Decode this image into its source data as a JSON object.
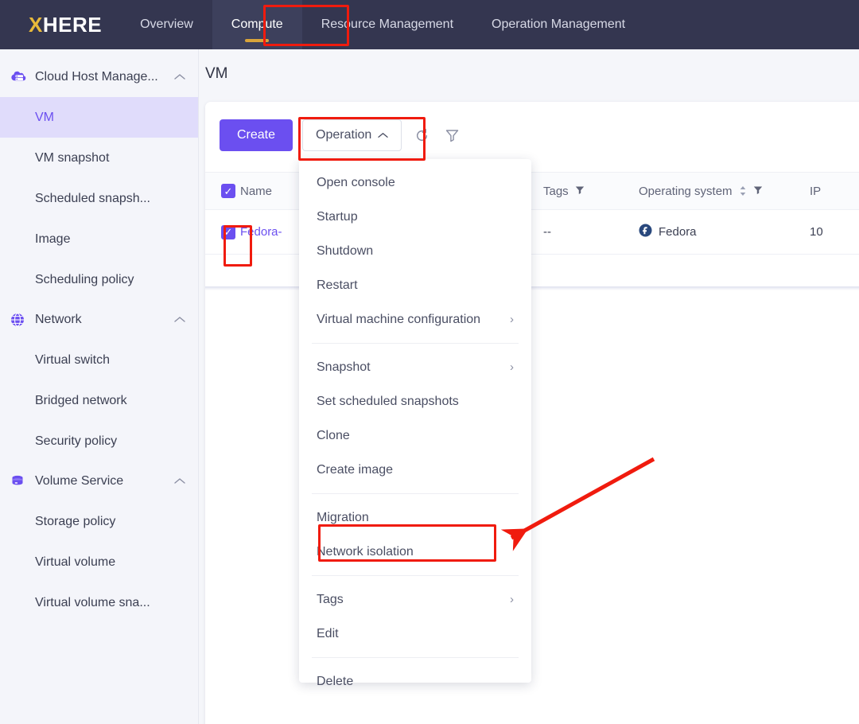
{
  "topnav": {
    "logo_x": "X",
    "logo_rest": "HERE",
    "items": [
      {
        "label": "Overview",
        "active": false
      },
      {
        "label": "Compute",
        "active": true
      },
      {
        "label": "Resource Management",
        "active": false
      },
      {
        "label": "Operation Management",
        "active": false
      }
    ]
  },
  "sidebar": {
    "groups": [
      {
        "label": "Cloud Host Manage...",
        "icon": "cloud-server-icon",
        "chevron": "⌃",
        "items": [
          {
            "label": "VM",
            "active": true
          },
          {
            "label": "VM snapshot",
            "active": false
          },
          {
            "label": "Scheduled snapsh...",
            "active": false
          },
          {
            "label": "Image",
            "active": false
          },
          {
            "label": "Scheduling policy",
            "active": false
          }
        ]
      },
      {
        "label": "Network",
        "icon": "globe-icon",
        "chevron": "⌃",
        "items": [
          {
            "label": "Virtual switch",
            "active": false
          },
          {
            "label": "Bridged network",
            "active": false
          },
          {
            "label": "Security policy",
            "active": false
          }
        ]
      },
      {
        "label": "Volume Service",
        "icon": "database-icon",
        "chevron": "⌃",
        "items": [
          {
            "label": "Storage policy",
            "active": false
          },
          {
            "label": "Virtual volume",
            "active": false
          },
          {
            "label": "Virtual volume sna...",
            "active": false
          }
        ]
      }
    ]
  },
  "page": {
    "title": "VM"
  },
  "toolbar": {
    "create_label": "Create",
    "operation_label": "Operation",
    "operation_chevron": "⌃",
    "refresh_icon": "refresh-icon",
    "filter_icon": "filter-icon"
  },
  "table": {
    "headers": {
      "name": "Name",
      "tags": "Tags",
      "os": "Operating system",
      "ip": "IP"
    },
    "header_checkbox_checked": true,
    "rows": [
      {
        "checked": true,
        "name": "Fedora-",
        "tags": "--",
        "os": "Fedora",
        "os_icon": "fedora-icon",
        "ip": "10"
      }
    ]
  },
  "menu": {
    "items": [
      {
        "label": "Open console",
        "submenu": false,
        "sep_after": false
      },
      {
        "label": "Startup",
        "submenu": false,
        "sep_after": false
      },
      {
        "label": "Shutdown",
        "submenu": false,
        "sep_after": false
      },
      {
        "label": "Restart",
        "submenu": false,
        "sep_after": false
      },
      {
        "label": "Virtual machine configuration",
        "submenu": true,
        "sep_after": true
      },
      {
        "label": "Snapshot",
        "submenu": true,
        "sep_after": false
      },
      {
        "label": "Set scheduled snapshots",
        "submenu": false,
        "sep_after": false
      },
      {
        "label": "Clone",
        "submenu": false,
        "sep_after": false
      },
      {
        "label": "Create image",
        "submenu": false,
        "sep_after": true
      },
      {
        "label": "Migration",
        "submenu": false,
        "sep_after": false
      },
      {
        "label": "Network isolation",
        "submenu": false,
        "sep_after": true
      },
      {
        "label": "Tags",
        "submenu": true,
        "sep_after": false
      },
      {
        "label": "Edit",
        "submenu": false,
        "sep_after": true
      },
      {
        "label": "Delete",
        "submenu": false,
        "sep_after": false
      }
    ],
    "submenu_chevron": "›"
  },
  "annotations": {
    "highlight_color": "#f01b0e",
    "boxes": [
      "compute-tab",
      "operation-button",
      "row-checkbox",
      "network-isolation-item"
    ],
    "arrow": "points-to-network-isolation"
  },
  "colors": {
    "nav_background": "#343650",
    "nav_active_background": "#3d405c",
    "nav_underline": "#d9a43a",
    "logo_accent": "#e8b93a",
    "primary": "#6b4ff0",
    "sidebar_active_background": "#e0dcfb",
    "page_background": "#f5f6fa",
    "annotation_red": "#f01b0e"
  }
}
